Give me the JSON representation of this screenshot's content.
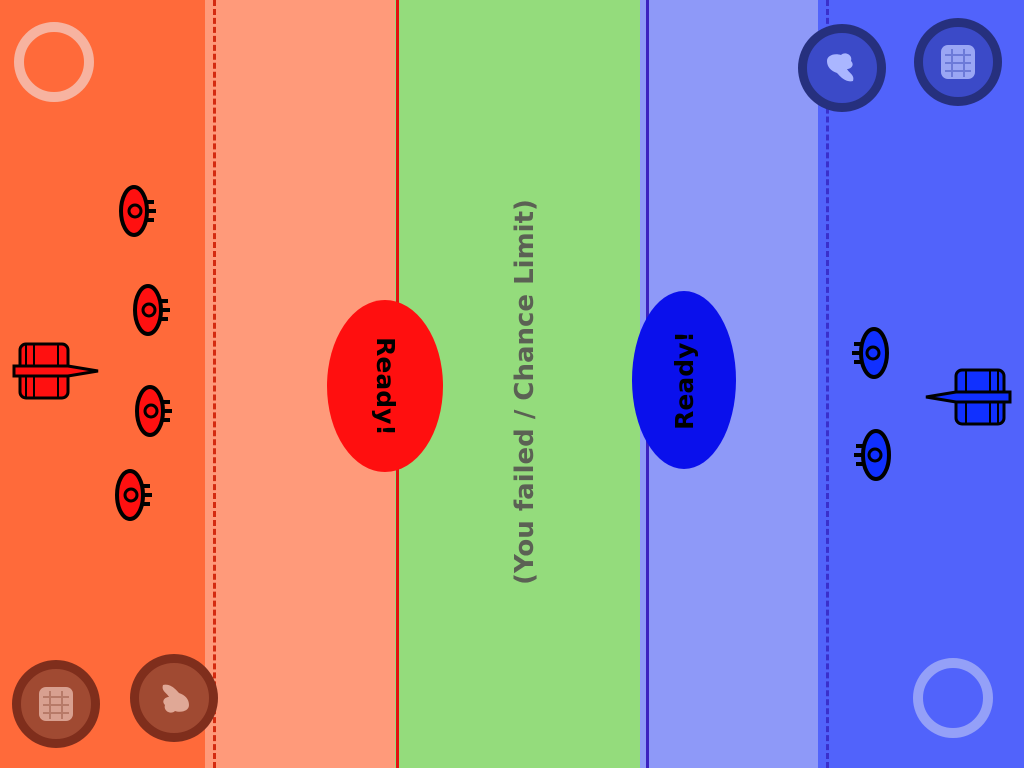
{
  "colors": {
    "red_base": "#ff6a3a",
    "red_field": "#ff9a7a",
    "neutral": "#94dc7c",
    "blue_field": "#8e99f8",
    "blue_base": "#5163fb",
    "red_unit": "#ff1010",
    "blue_unit": "#1030ff"
  },
  "red_team": {
    "ready_label": "Ready!",
    "units": [
      "turret",
      "turret",
      "turret",
      "turret",
      "ship"
    ],
    "controls": [
      "move-ring-icon",
      "fortify-icon",
      "creature-icon"
    ]
  },
  "blue_team": {
    "ready_label": "Ready!",
    "units": [
      "turret",
      "turret",
      "ship"
    ],
    "controls": [
      "move-ring-icon",
      "fortify-icon",
      "creature-icon"
    ]
  },
  "status": {
    "message": "(You failed / Chance Limit)"
  }
}
